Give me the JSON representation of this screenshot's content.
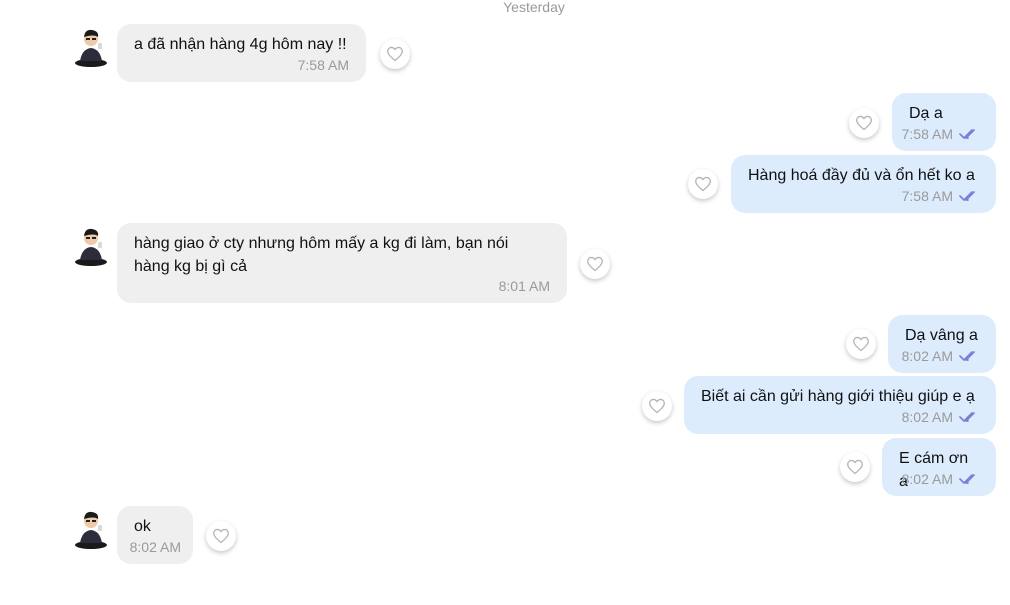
{
  "date_separator": "Yesterday",
  "messages": [
    {
      "direction": "incoming",
      "text": "a đã nhận hàng 4g hôm nay !!",
      "time": "7:58 AM",
      "icon": "heart-reaction-icon"
    },
    {
      "direction": "outgoing",
      "text": "Dạ a",
      "time": "7:58 AM",
      "status_icon": "double-check-icon"
    },
    {
      "direction": "outgoing",
      "text": "Hàng hoá đầy đủ và ổn hết ko a",
      "time": "7:58 AM",
      "status_icon": "double-check-icon"
    },
    {
      "direction": "incoming",
      "text": "hàng giao ở cty nhưng hôm mấy a kg đi làm, bạn nói\nhàng kg bị gì cả",
      "time": "8:01 AM"
    },
    {
      "direction": "outgoing",
      "text": "Dạ vâng a",
      "time": "8:02 AM",
      "status_icon": "double-check-icon"
    },
    {
      "direction": "outgoing",
      "text": "Biết ai cần gửi hàng giới thiệu giúp e ạ",
      "time": "8:02 AM",
      "status_icon": "double-check-icon"
    },
    {
      "direction": "outgoing",
      "text": "E cám ơn a",
      "time": "8:02 AM",
      "status_icon": "double-check-icon"
    },
    {
      "direction": "incoming",
      "text": "ok",
      "time": "8:02 AM"
    }
  ],
  "colors": {
    "incoming_bubble": "#efefef",
    "outgoing_bubble": "#dcecfd",
    "read_ticks": "#7b7fd6",
    "timestamp": "#9a9a9a"
  }
}
